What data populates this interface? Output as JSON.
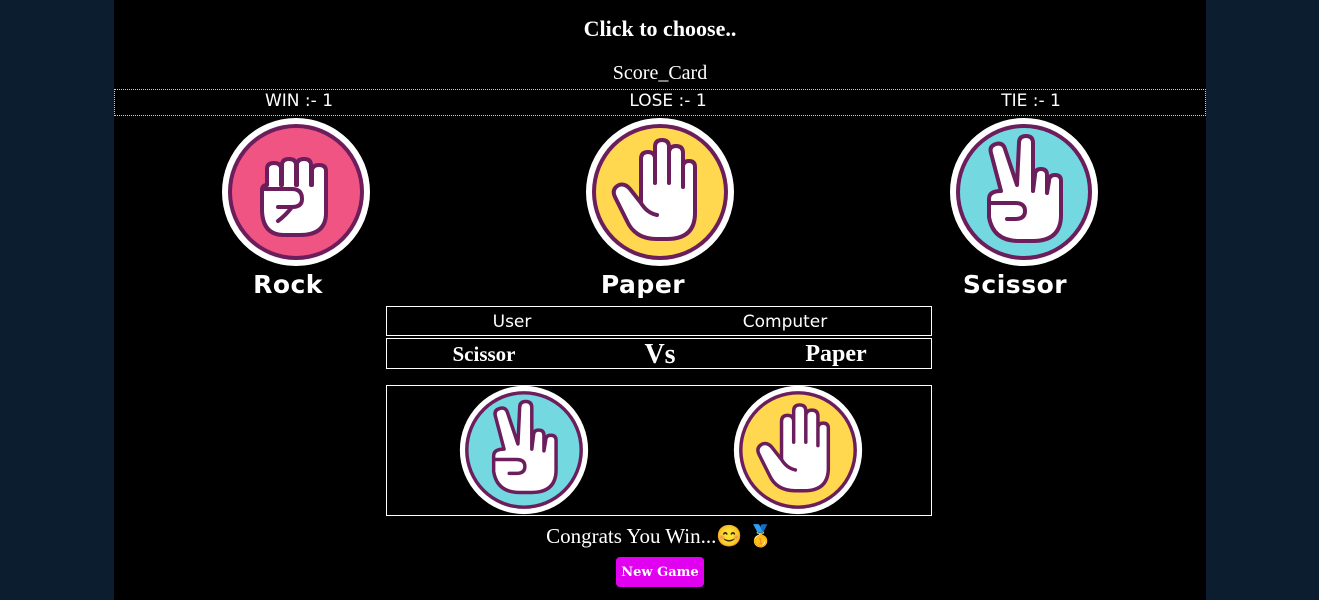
{
  "instruction": "Click to choose..",
  "scorecard": {
    "title": "Score_Card",
    "win": "WIN :- 1",
    "lose": "LOSE :- 1",
    "tie": "TIE :- 1"
  },
  "choices": [
    {
      "label": "Rock",
      "icon": "fist-icon",
      "color": "#ef5483"
    },
    {
      "label": "Paper",
      "icon": "open-hand-icon",
      "color": "#ffd84f"
    },
    {
      "label": "Scissor",
      "icon": "peace-hand-icon",
      "color": "#74d8e1"
    }
  ],
  "versus": {
    "user_header": "User",
    "computer_header": "Computer",
    "user_choice": "Scissor",
    "vs_label": "Vs",
    "computer_choice": "Paper"
  },
  "result": {
    "user_icon": "peace-hand-icon",
    "computer_icon": "open-hand-icon",
    "message": "Congrats You Win...😊 🥇"
  },
  "new_game_label": "New Game",
  "colors": {
    "background_outer": "#0c1d30",
    "background_app": "#000000",
    "button": "#e100f0",
    "outline": "#6b1d5c"
  }
}
